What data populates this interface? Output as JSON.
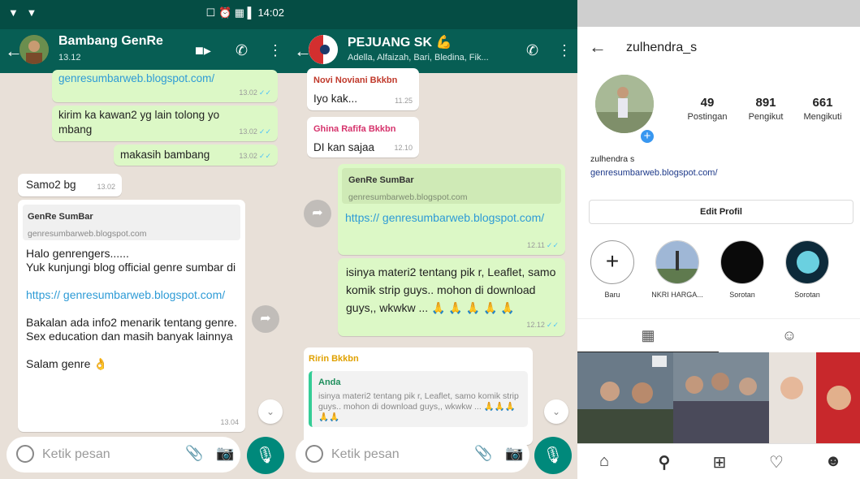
{
  "screen1": {
    "status": {
      "left": "▼ ▼",
      "right": "☐ ⏰ ▦ ▌ 14:02"
    },
    "header": {
      "title": "Bambang GenRe",
      "subtitle": "13.12"
    },
    "messages": [
      {
        "kind": "out",
        "text": "genresumbarweb.blogspot.com/",
        "time": "13.02"
      },
      {
        "kind": "out",
        "text": "kirim ka kawan2 yg lain tolong yo mbang",
        "time": "13.02"
      },
      {
        "kind": "out",
        "text": "makasih bambang",
        "time": "13.02"
      },
      {
        "kind": "in",
        "text": "Samo2 bg",
        "time": "13.02"
      }
    ],
    "preview": {
      "title": "GenRe SumBar",
      "domain": "genresumbarweb.blogspot.com"
    },
    "long_message": {
      "p1": "Halo genrengers......",
      "p2": "Yuk kunjungi blog official genre sumbar di",
      "link": "https:// genresumbarweb.blogspot.com/",
      "p3": "Bakalan ada info2 menarik tentang genre. Sex education dan masih banyak lainnya",
      "p4": "Salam genre 👌",
      "time": "13.04"
    },
    "input_placeholder": "Ketik pesan"
  },
  "screen2": {
    "header": {
      "title": "PEJUANG SK 💪",
      "subtitle": "Adella, Alfaizah, Bari, Bledina, Fik..."
    },
    "messages": [
      {
        "sender": "Novi Noviani Bkkbn",
        "sender_color": "#c0392b",
        "text": "Iyo kak...",
        "time": "11.25"
      },
      {
        "sender": "Ghina Rafifa Bkkbn",
        "sender_color": "#d6336c",
        "text": "DI kan sajaa",
        "time": "12.10"
      }
    ],
    "forward1": {
      "title": "GenRe SumBar",
      "domain": "genresumbarweb.blogspot.com",
      "link": "https:// genresumbarweb.blogspot.com/",
      "time": "12.11"
    },
    "forward2": {
      "text": "isinya materi2 tentang pik r, Leaflet, samo komik strip guys.. mohon di download guys,, wkwkw ... 🙏 🙏 🙏 🙏 🙏",
      "time": "12.12"
    },
    "reply": {
      "sender": "Ririn Bkkbn",
      "quote_author": "Anda",
      "quote_text": "isinya materi2 tentang pik r, Leaflet, samo komik strip guys.. mohon di download guys,, wkwkw ... 🙏🙏🙏🙏🙏"
    },
    "input_placeholder": "Ketik pesan"
  },
  "screen3": {
    "username": "zulhendra_s",
    "stats": [
      {
        "value": "49",
        "label": "Postingan"
      },
      {
        "value": "891",
        "label": "Pengikut"
      },
      {
        "value": "661",
        "label": "Mengikuti"
      }
    ],
    "name": "zulhendra s",
    "website": "genresumbarweb.blogspot.com/",
    "edit_button": "Edit Profil",
    "highlights": [
      {
        "label": "Baru"
      },
      {
        "label": "NKRI HARGA..."
      },
      {
        "label": "Sorotan"
      },
      {
        "label": "Sorotan"
      }
    ],
    "colors": {
      "wa_header": "#075e54",
      "wa_out": "#dcf8c6",
      "ig_blue": "#3897f0"
    }
  }
}
